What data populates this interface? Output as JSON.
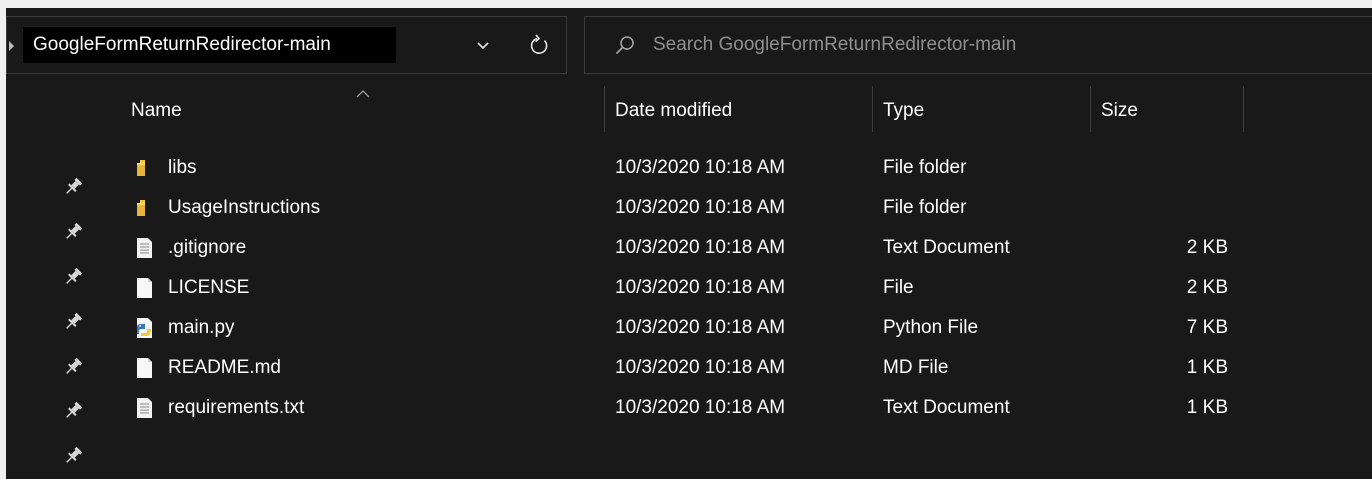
{
  "address_bar": {
    "path": "GoogleFormReturnRedirector-main",
    "dropdown_icon": "chevron-down-icon",
    "refresh_icon": "refresh-icon"
  },
  "search": {
    "placeholder": "Search GoogleFormReturnRedirector-main",
    "icon": "search-icon"
  },
  "columns": {
    "name": "Name",
    "date_modified": "Date modified",
    "type": "Type",
    "size": "Size",
    "sort_indicator": "sort-ascending-icon"
  },
  "quick_access_pins": 7,
  "files": [
    {
      "name": "libs",
      "date": "10/3/2020 10:18 AM",
      "type": "File folder",
      "size": "",
      "icon": "folder-icon"
    },
    {
      "name": "UsageInstructions",
      "date": "10/3/2020 10:18 AM",
      "type": "File folder",
      "size": "",
      "icon": "folder-icon"
    },
    {
      "name": ".gitignore",
      "date": "10/3/2020 10:18 AM",
      "type": "Text Document",
      "size": "2 KB",
      "icon": "text-document-icon"
    },
    {
      "name": "LICENSE",
      "date": "10/3/2020 10:18 AM",
      "type": "File",
      "size": "2 KB",
      "icon": "blank-file-icon"
    },
    {
      "name": "main.py",
      "date": "10/3/2020 10:18 AM",
      "type": "Python File",
      "size": "7 KB",
      "icon": "python-file-icon"
    },
    {
      "name": "README.md",
      "date": "10/3/2020 10:18 AM",
      "type": "MD File",
      "size": "1 KB",
      "icon": "blank-file-icon"
    },
    {
      "name": "requirements.txt",
      "date": "10/3/2020 10:18 AM",
      "type": "Text Document",
      "size": "1 KB",
      "icon": "text-document-icon"
    }
  ],
  "colors": {
    "background": "#191919",
    "text": "#ffffff",
    "placeholder": "#8f8f8f",
    "border": "#3a3a3a",
    "folder": "#f5c94b"
  }
}
